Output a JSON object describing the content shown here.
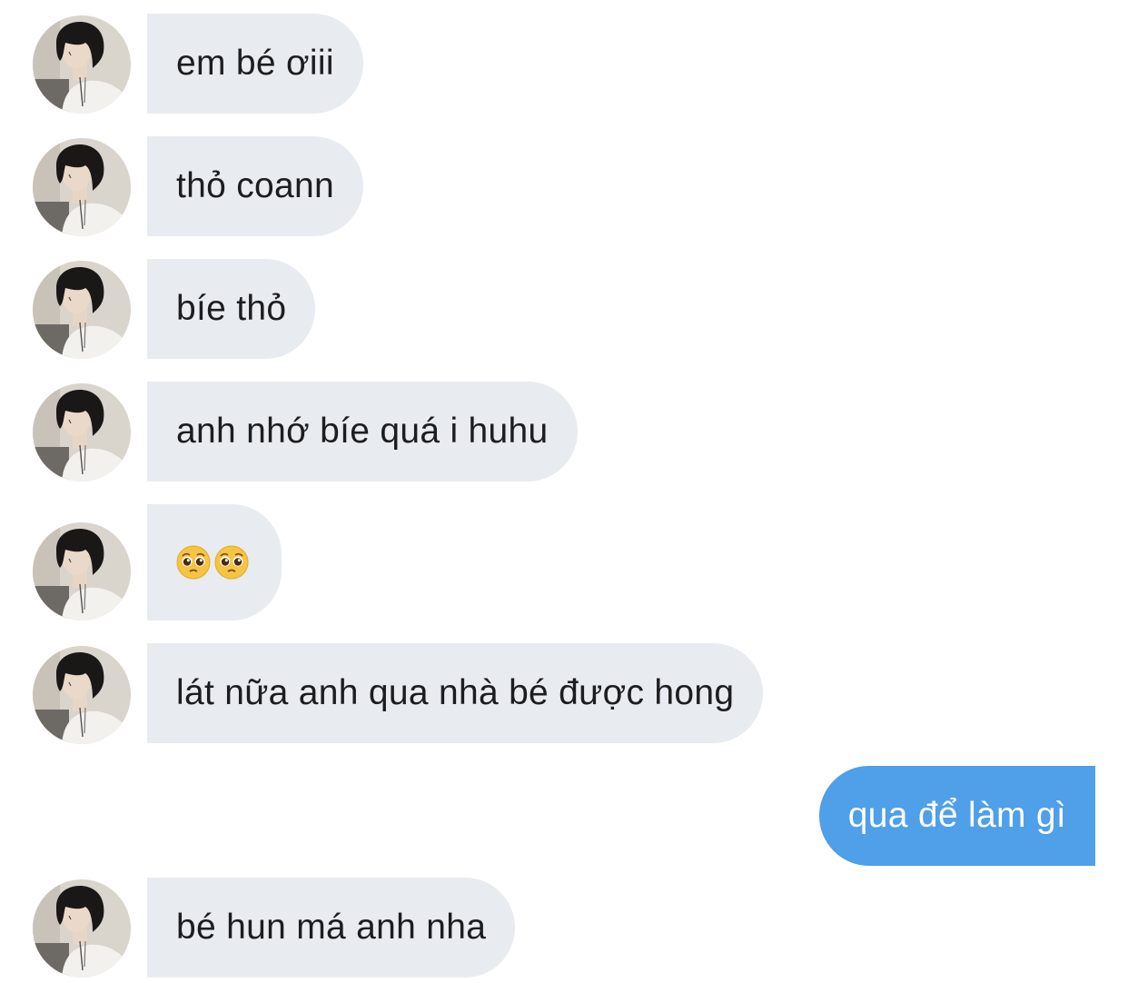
{
  "conversation": {
    "messages": [
      {
        "direction": "incoming",
        "text": "em bé ơiii",
        "has_avatar": true
      },
      {
        "direction": "incoming",
        "text": "thỏ coann",
        "has_avatar": true
      },
      {
        "direction": "incoming",
        "text": "bíe thỏ",
        "has_avatar": true
      },
      {
        "direction": "incoming",
        "text": "anh nhớ bíe quá i huhu",
        "has_avatar": true
      },
      {
        "direction": "incoming",
        "emoji": [
          "pleading-face",
          "pleading-face"
        ],
        "has_avatar": true
      },
      {
        "direction": "incoming",
        "text": "lát nữa anh qua nhà bé được hong",
        "has_avatar": true
      },
      {
        "direction": "outgoing",
        "text": "qua để làm gì",
        "has_avatar": false
      },
      {
        "direction": "incoming",
        "text": "bé hun má anh nha",
        "has_avatar": true
      }
    ]
  },
  "colors": {
    "incoming_bubble": "#e8ebef",
    "incoming_text": "#1c1d20",
    "outgoing_bubble": "#4f9fe9",
    "outgoing_text": "#ffffff",
    "emoji_face": "#f6c443"
  }
}
